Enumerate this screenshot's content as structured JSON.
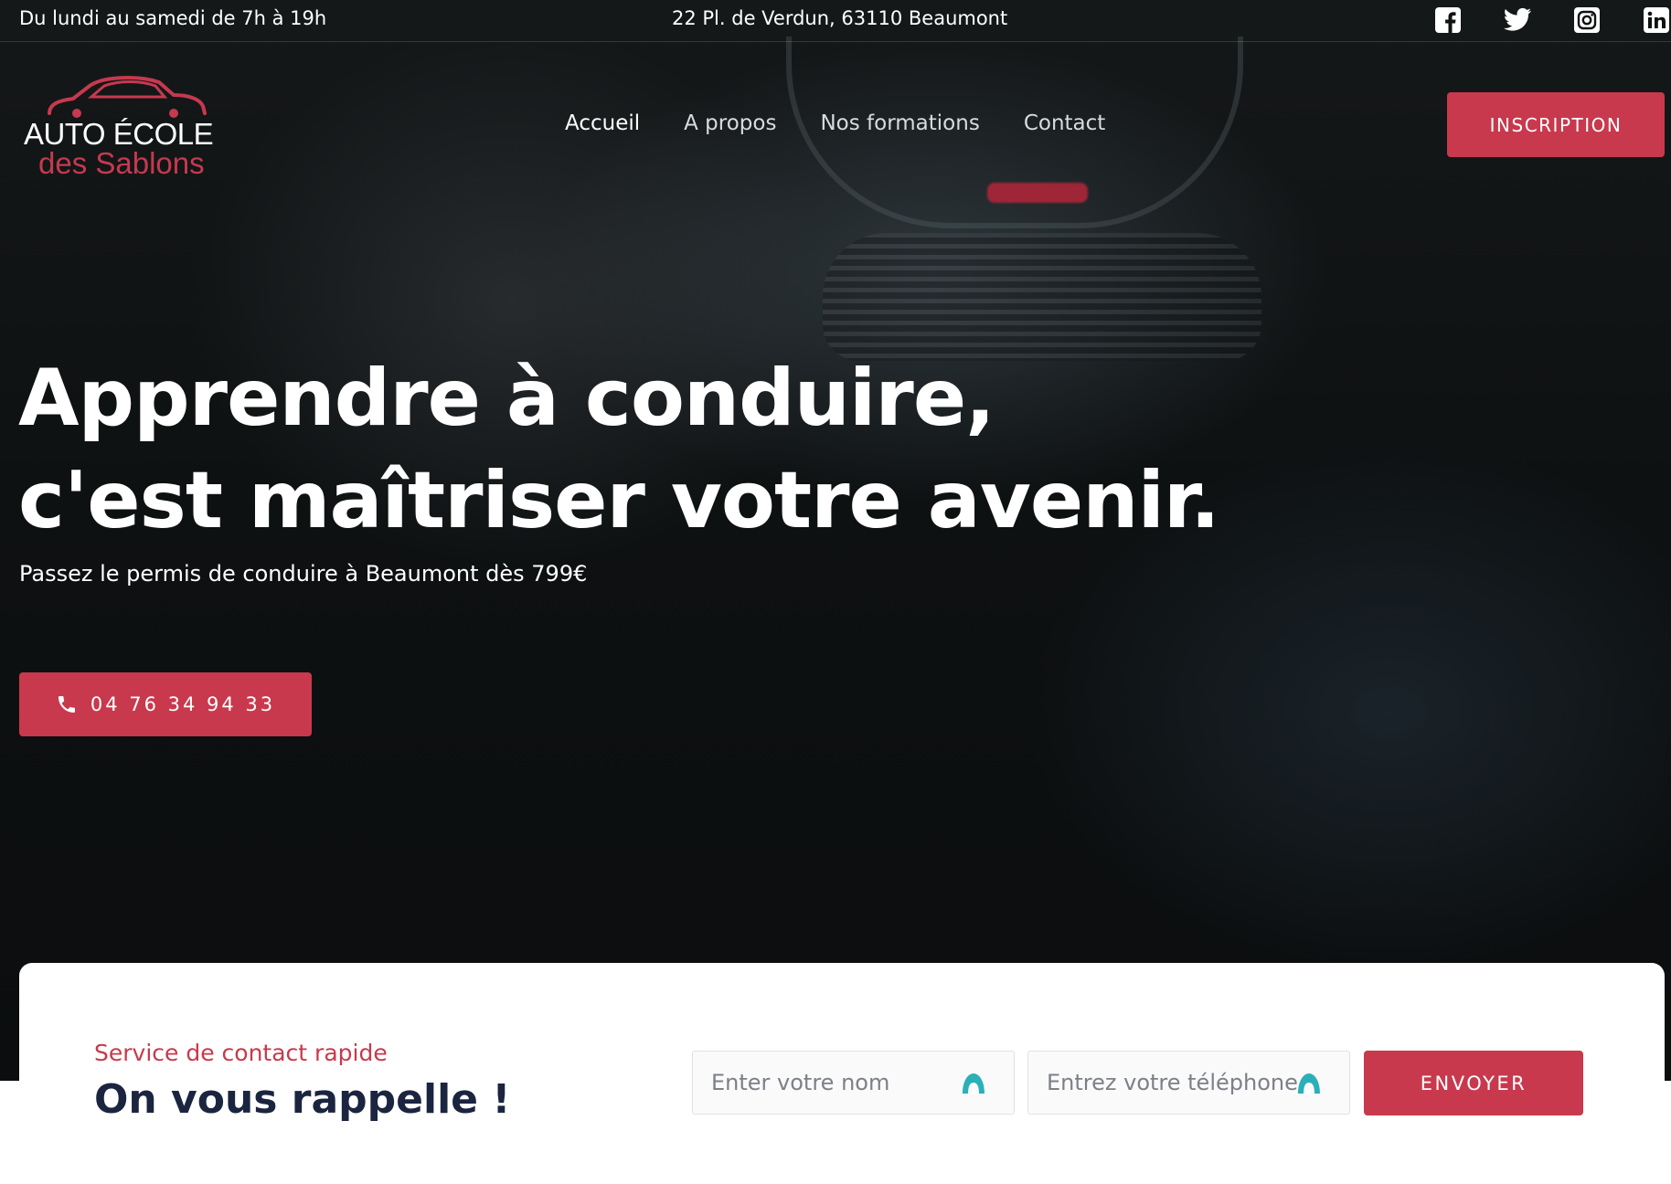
{
  "topbar": {
    "hours": "Du lundi au samedi de 7h à 19h",
    "address": "22 Pl. de Verdun, 63110 Beaumont",
    "socials": [
      "facebook-icon",
      "twitter-icon",
      "instagram-icon",
      "linkedin-icon"
    ]
  },
  "logo": {
    "line1": "AUTO ÉCOLE",
    "line2": "des Sablons",
    "icon": "car-icon"
  },
  "nav": {
    "items": [
      {
        "label": "Accueil",
        "active": true
      },
      {
        "label": "A propos",
        "active": false
      },
      {
        "label": "Nos formations",
        "active": false
      },
      {
        "label": "Contact",
        "active": false
      }
    ],
    "cta_label": "INSCRIPTION"
  },
  "hero": {
    "headline_line1": "Apprendre à conduire,",
    "headline_line2": "c'est maîtriser votre avenir.",
    "subline": "Passez le permis de conduire à Beaumont dès 799€",
    "phone_label": "04 76 34 94 33",
    "phone_icon": "phone-icon"
  },
  "contact": {
    "eyebrow": "Service de contact rapide",
    "title": "On vous rappelle !",
    "name_placeholder": "Enter votre nom",
    "phone_placeholder": "Entrez votre téléphone",
    "submit_label": "ENVOYER"
  },
  "colors": {
    "accent": "#c8394d",
    "title_dark": "#1b2540",
    "field_icon": "#2ab0b8"
  }
}
